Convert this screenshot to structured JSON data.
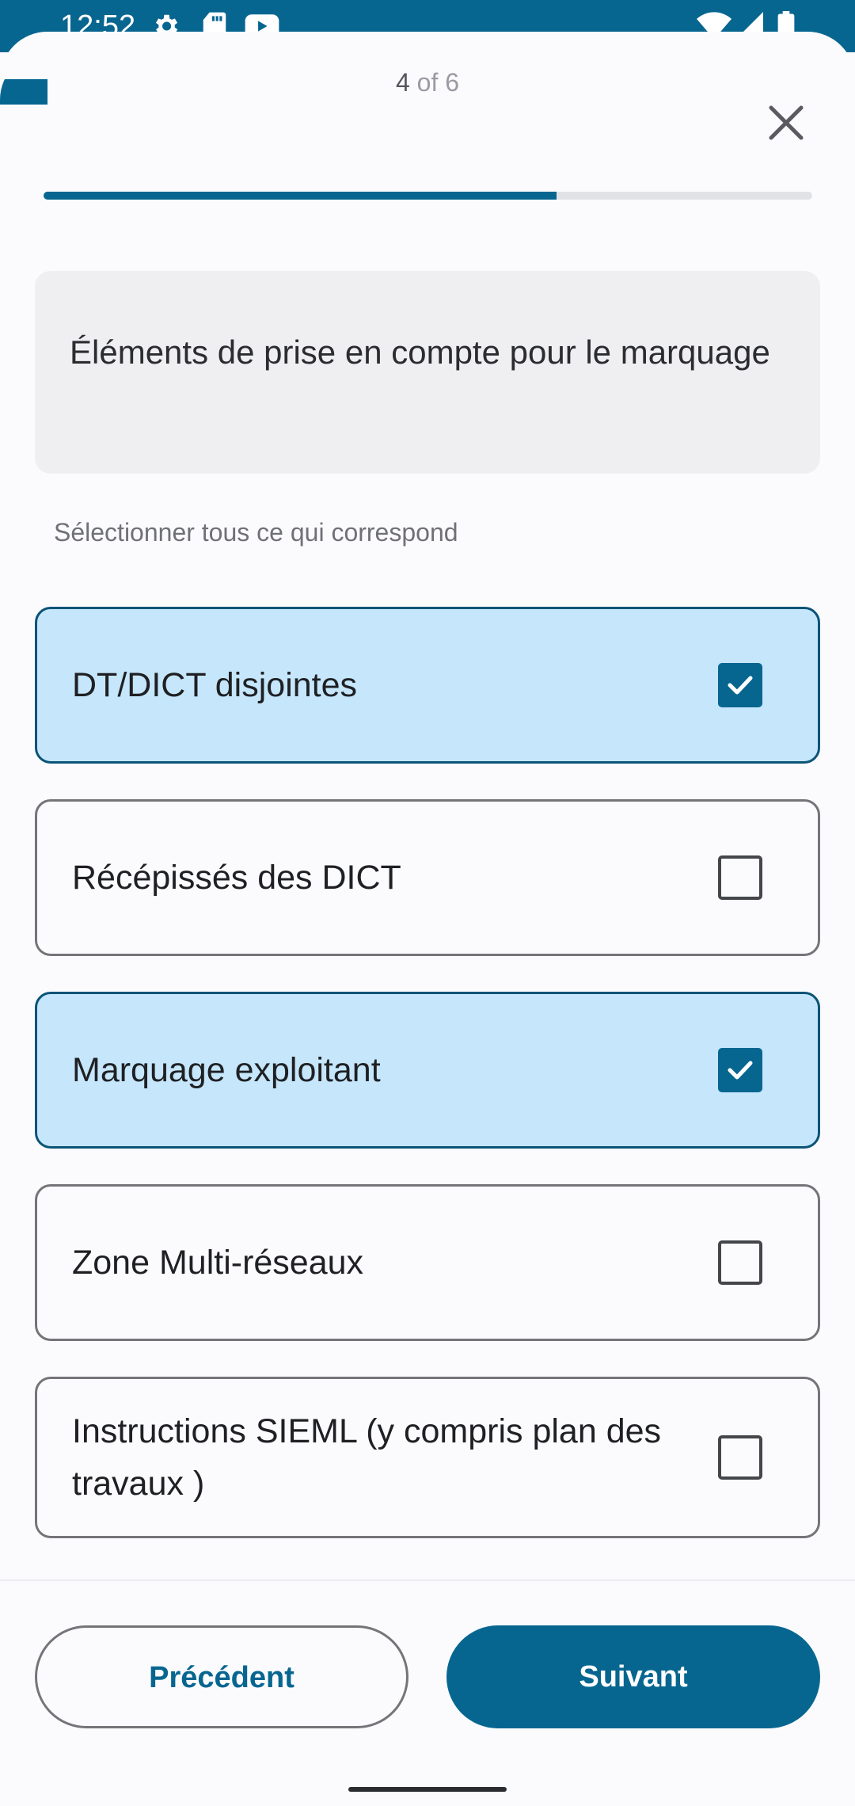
{
  "status_bar": {
    "time": "12:52",
    "left_icons": [
      "settings-icon",
      "sd-card-icon",
      "youtube-icon"
    ],
    "right_icons": [
      "wifi-icon",
      "signal-icon",
      "battery-icon"
    ]
  },
  "header": {
    "step_current": "4",
    "step_of": "of 6",
    "progress": 0.667
  },
  "question": {
    "title": "Éléments de prise en compte pour le marquage",
    "hint": "Sélectionner tous ce qui correspond"
  },
  "options": [
    {
      "label": "DT/DICT disjointes",
      "checked": true
    },
    {
      "label": "Récépissés des DICT",
      "checked": false
    },
    {
      "label": "Marquage exploitant",
      "checked": true
    },
    {
      "label": "Zone Multi-réseaux",
      "checked": false
    },
    {
      "label": "Instructions SIEML (y compris plan des travaux )",
      "checked": false
    }
  ],
  "footer": {
    "prev_label": "Précédent",
    "next_label": "Suivant"
  },
  "colors": {
    "primary": "#066690",
    "selected_bg": "#c5e6fb",
    "surface": "#fbfbfd"
  }
}
